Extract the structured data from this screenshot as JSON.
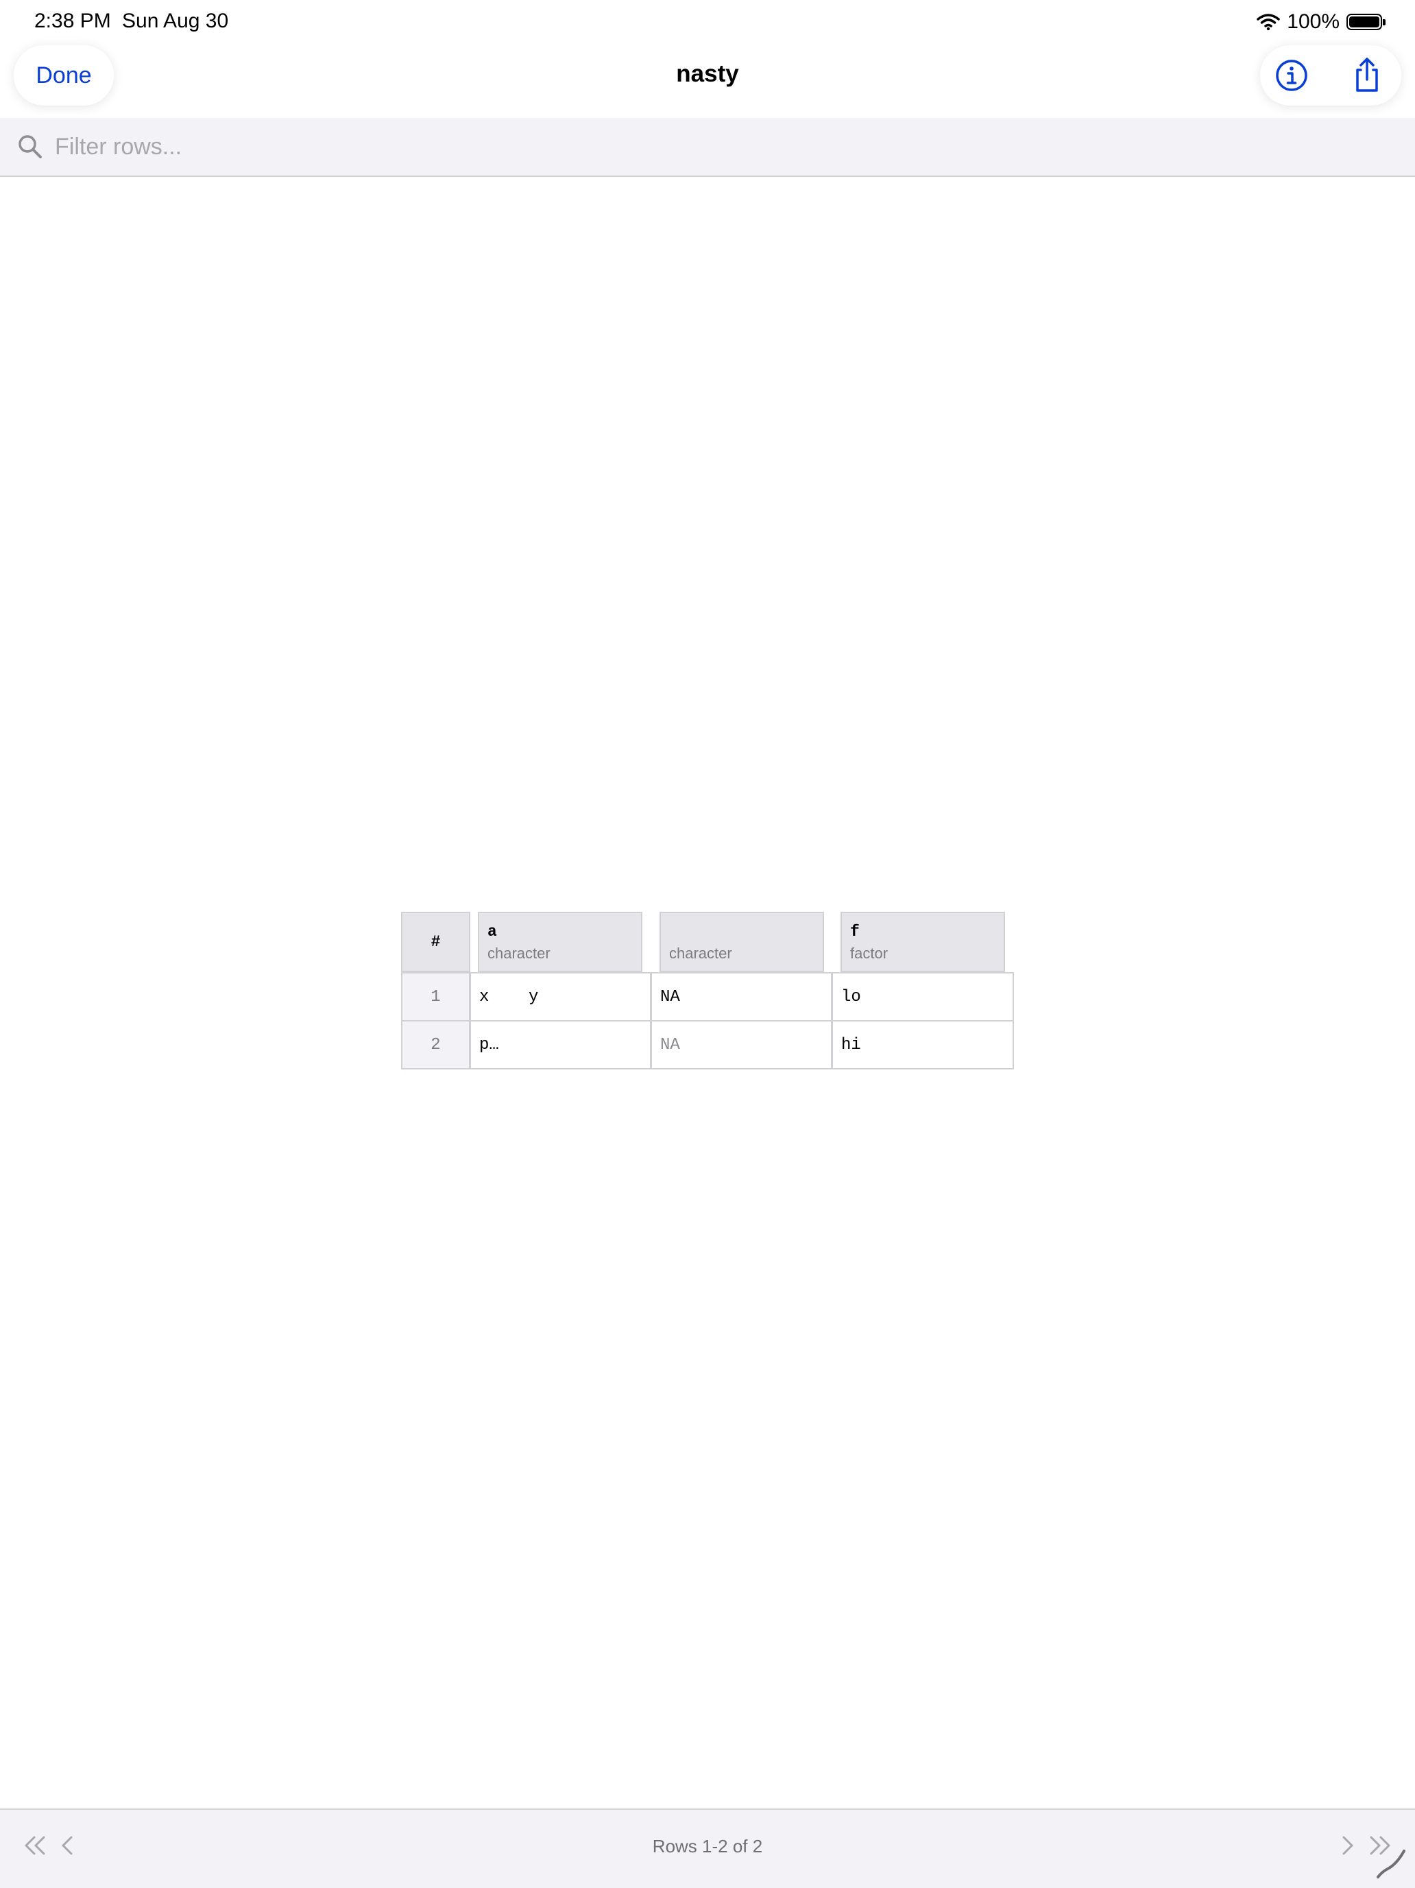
{
  "status_bar": {
    "time": "2:38 PM",
    "date": "Sun Aug 30",
    "battery": "100%"
  },
  "nav": {
    "done_label": "Done",
    "title": "nasty"
  },
  "search": {
    "placeholder": "Filter rows...",
    "value": ""
  },
  "table": {
    "index_header": "#",
    "columns": [
      {
        "name": "a",
        "type": "character"
      },
      {
        "name": "",
        "type": "character"
      },
      {
        "name": "f",
        "type": "factor"
      }
    ],
    "rows": [
      {
        "index": "1",
        "cells": [
          "x    y",
          "NA",
          "lo"
        ]
      },
      {
        "index": "2",
        "cells": [
          "p…",
          "NA",
          "hi"
        ]
      }
    ]
  },
  "footer": {
    "status": "Rows 1-2 of 2"
  },
  "colors": {
    "accent": "#0a3fd6",
    "header_bg": "#e5e5ea",
    "bar_bg": "#f2f2f7"
  }
}
